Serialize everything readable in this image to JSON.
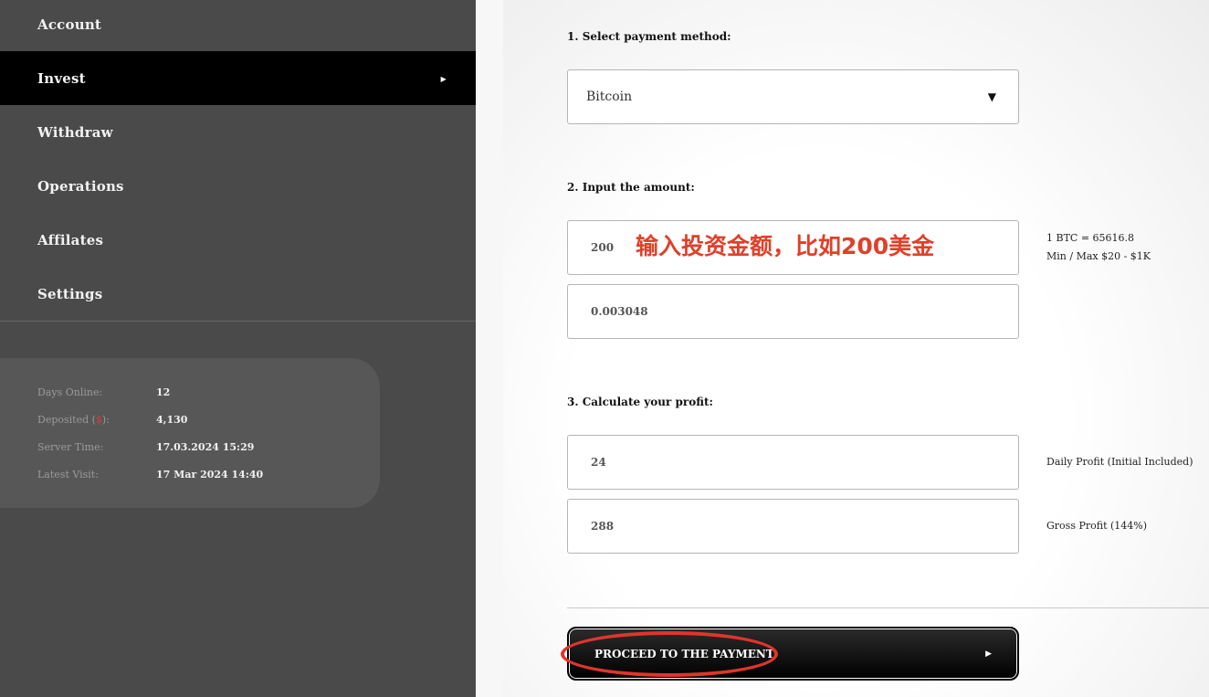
{
  "sidebar": {
    "items": [
      {
        "label": "Account",
        "active": false
      },
      {
        "label": "Invest",
        "active": true
      },
      {
        "label": "Withdraw",
        "active": false
      },
      {
        "label": "Operations",
        "active": false
      },
      {
        "label": "Affilates",
        "active": false
      },
      {
        "label": "Settings",
        "active": false
      }
    ],
    "active_arrow": "▶",
    "stats": {
      "days_online_label": "Days Online:",
      "days_online_value": "12",
      "deposited_label_prefix": "Deposited (",
      "deposited_label_symbol": "$",
      "deposited_label_suffix": "):",
      "deposited_value": "4,130",
      "server_time_label": "Server Time:",
      "server_time_value": "17.03.2024 15:29",
      "latest_visit_label": "Latest Visit:",
      "latest_visit_value": "17 Mar 2024 14:40"
    }
  },
  "form": {
    "step1_title": "1. Select payment method:",
    "payment_method": "Bitcoin",
    "select_arrow": "▼",
    "step2_title": "2. Input the amount:",
    "amount_usd": "200",
    "amount_annotation": "输入投资金额，比如200美金",
    "amount_btc": "0.003048",
    "rate_note": "1 BTC = 65616.8",
    "limit_note": "Min / Max $20 - $1K",
    "step3_title": "3. Calculate your profit:",
    "daily_profit": "24",
    "daily_profit_label": "Daily Profit (Initial Included)",
    "gross_profit": "288",
    "gross_profit_label": "Gross Profit (144%)",
    "proceed_label": "PROCEED TO THE PAYMENT",
    "proceed_arrow": "▶"
  },
  "colors": {
    "sidebar_bg": "#4a4a4a",
    "active_bg": "#000000",
    "annotation": "#e0402a"
  }
}
